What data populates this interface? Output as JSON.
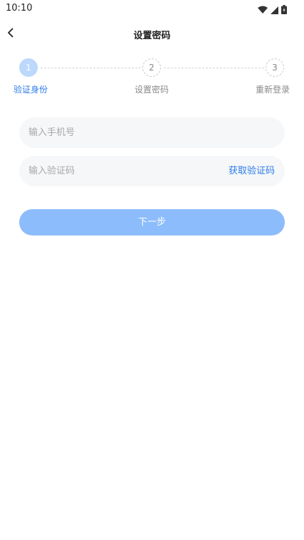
{
  "status_bar": {
    "time": "10:10",
    "icons": [
      "wifi-icon",
      "signal-icon",
      "battery-icon"
    ]
  },
  "nav": {
    "back_icon": "chevron-left-icon",
    "title": "设置密码"
  },
  "steps": [
    {
      "number": "1",
      "label": "验证身份",
      "state": "active"
    },
    {
      "number": "2",
      "label": "设置密码",
      "state": "inactive"
    },
    {
      "number": "3",
      "label": "重新登录",
      "state": "inactive"
    }
  ],
  "form": {
    "phone_placeholder": "输入手机号",
    "phone_value": "",
    "code_placeholder": "输入验证码",
    "code_value": "",
    "get_code_label": "获取验证码",
    "next_label": "下一步"
  },
  "colors": {
    "accent": "#2b7de9",
    "button_disabled": "#8cbcfb",
    "step_active": "#bcd8fb",
    "input_background": "#f6f7f8"
  }
}
